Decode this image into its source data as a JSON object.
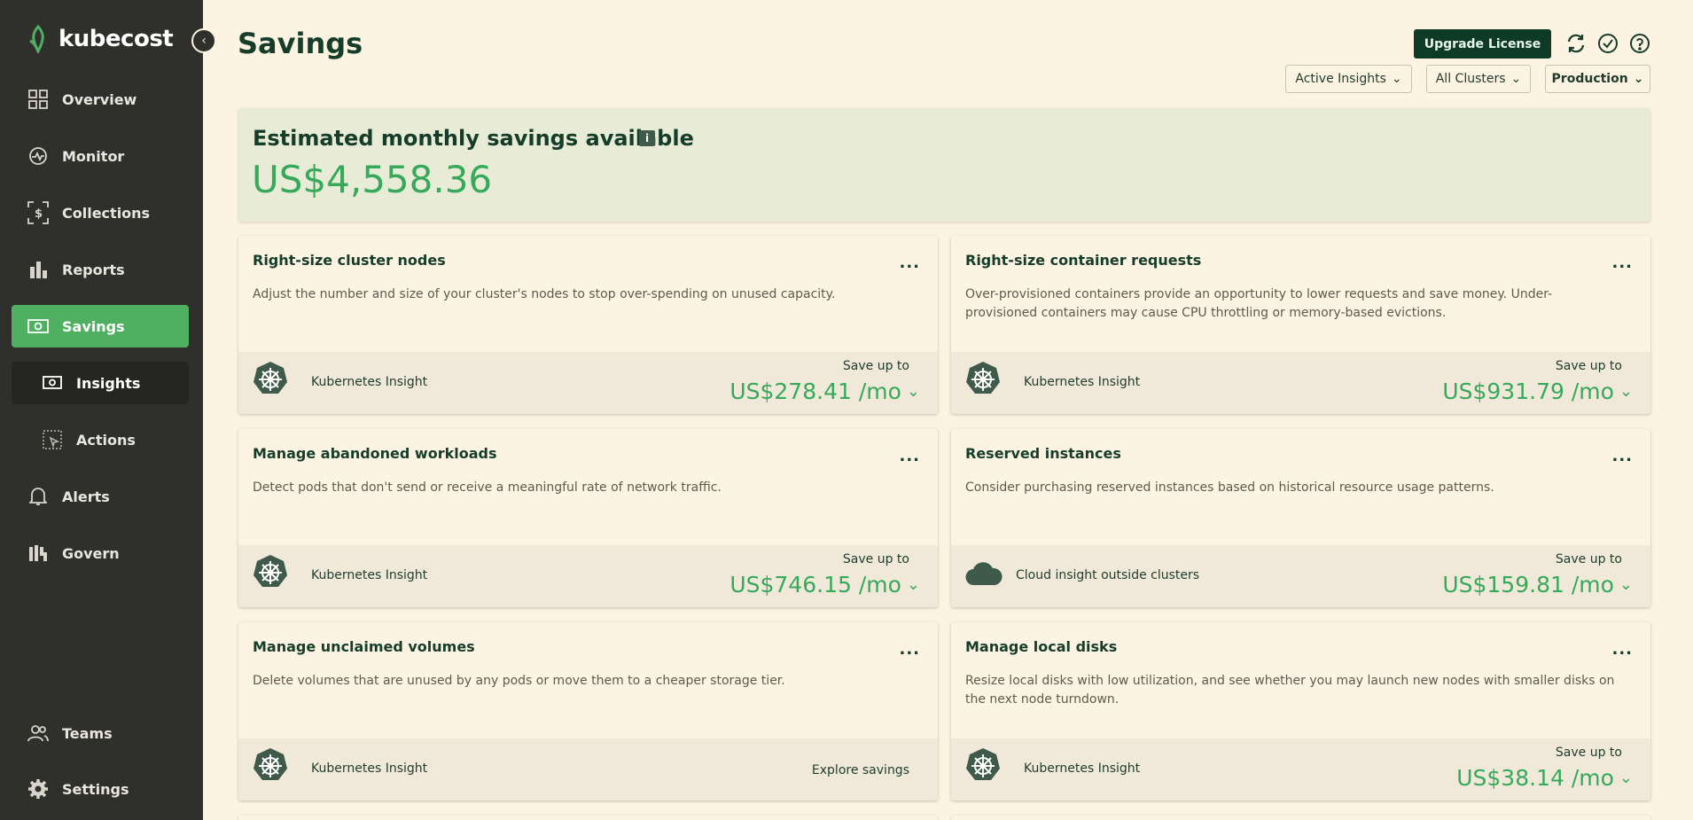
{
  "app": {
    "name": "kubecost"
  },
  "sidebar": {
    "items": [
      {
        "label": "Overview",
        "icon": "grid-icon"
      },
      {
        "label": "Monitor",
        "icon": "monitor-icon"
      },
      {
        "label": "Collections",
        "icon": "collections-icon"
      },
      {
        "label": "Reports",
        "icon": "bar-chart-icon"
      },
      {
        "label": "Savings",
        "icon": "savings-icon",
        "active": true
      },
      {
        "label": "Insights",
        "icon": "insights-icon",
        "sub": true,
        "current": true
      },
      {
        "label": "Actions",
        "icon": "actions-icon",
        "sub": true
      },
      {
        "label": "Alerts",
        "icon": "bell-icon"
      },
      {
        "label": "Govern",
        "icon": "govern-icon"
      },
      {
        "label": "Teams",
        "icon": "teams-icon"
      },
      {
        "label": "Settings",
        "icon": "gear-icon"
      }
    ]
  },
  "header": {
    "title": "Savings",
    "upgrade_label": "Upgrade License",
    "filters": [
      "Active Insights",
      "All Clusters",
      "Production"
    ]
  },
  "summary": {
    "title": "Estimated monthly savings available",
    "info_label": "i",
    "value": "US$4,558.36"
  },
  "cards": [
    {
      "title": "Right-size cluster nodes",
      "menu": "...",
      "description": "Adjust the number and size of your cluster's nodes to stop over-spending on unused capacity.",
      "insight_type": "Kubernetes Insight",
      "save_label": "Save up to",
      "amount": "US$278.41 /mo"
    },
    {
      "title": "Right-size container requests",
      "menu": "...",
      "description": "Over-provisioned containers provide an opportunity to lower requests and save money. Under-provisioned containers may cause CPU throttling or memory-based evictions.",
      "insight_type": "Kubernetes Insight",
      "save_label": "Save up to",
      "amount": "US$931.79 /mo"
    },
    {
      "title": "Manage abandoned workloads",
      "menu": "...",
      "description": "Detect pods that don't send or receive a meaningful rate of network traffic.",
      "insight_type": "Kubernetes Insight",
      "save_label": "Save up to",
      "amount": "US$746.15 /mo"
    },
    {
      "title": "Reserved instances",
      "menu": "...",
      "description": "Consider purchasing reserved instances based on historical resource usage patterns.",
      "insight_type": "Cloud insight outside clusters",
      "save_label": "Save up to",
      "amount": "US$159.81 /mo"
    },
    {
      "title": "Manage unclaimed volumes",
      "menu": "...",
      "description": "Delete volumes that are unused by any pods or move them to a cheaper storage tier.",
      "insight_type": "Kubernetes Insight",
      "explore_label": "Explore savings"
    },
    {
      "title": "Manage local disks",
      "menu": "...",
      "description": "Resize local disks with low utilization, and see whether you may launch new nodes with smaller disks on the next node turndown.",
      "insight_type": "Kubernetes Insight",
      "save_label": "Save up to",
      "amount": "US$38.14 /mo"
    }
  ],
  "colors": {
    "background": "#fdf3e3",
    "sidebar": "#2f2f2b",
    "accent_green": "#4fb062",
    "amount_green": "#37a95a",
    "dark_green": "#0e3a28"
  }
}
